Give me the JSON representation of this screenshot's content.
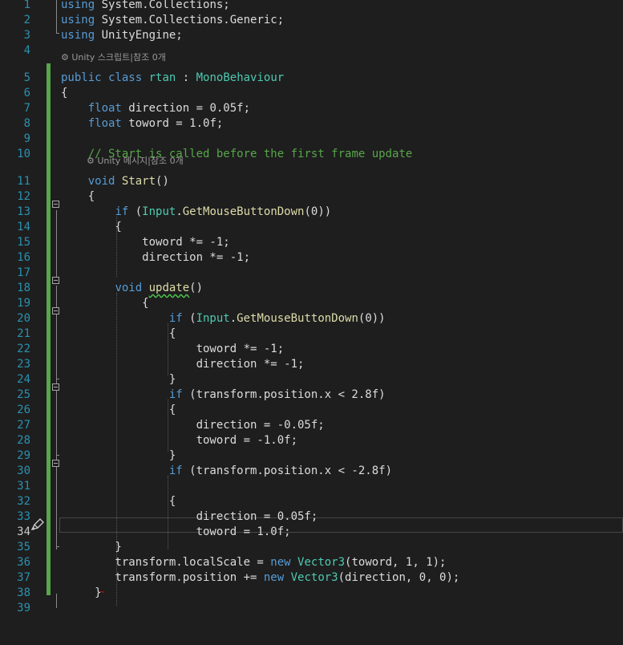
{
  "editor": {
    "current_line": "34",
    "lens_class": "Unity 스크립트|참조 0개",
    "lens_method": "Unity 메시지|참조 0개",
    "lines": [
      {
        "n": "1",
        "segs": [
          {
            "t": "using",
            "c": "kw"
          },
          {
            "t": " System.Collections;",
            "c": "id"
          }
        ]
      },
      {
        "n": "2",
        "segs": [
          {
            "t": "using",
            "c": "kw"
          },
          {
            "t": " System.Collections.Generic;",
            "c": "id"
          }
        ]
      },
      {
        "n": "3",
        "segs": [
          {
            "t": "using",
            "c": "kw"
          },
          {
            "t": " UnityEngine;",
            "c": "id"
          }
        ]
      },
      {
        "n": "4",
        "segs": []
      },
      {
        "n": "5",
        "segs": [
          {
            "t": "public",
            "c": "kw"
          },
          {
            "t": " ",
            "c": "id"
          },
          {
            "t": "class",
            "c": "kw"
          },
          {
            "t": " ",
            "c": "id"
          },
          {
            "t": "rtan",
            "c": "ty"
          },
          {
            "t": " : ",
            "c": "id"
          },
          {
            "t": "MonoBehaviour",
            "c": "ty"
          }
        ]
      },
      {
        "n": "6",
        "segs": [
          {
            "t": "{",
            "c": "id"
          }
        ]
      },
      {
        "n": "7",
        "segs": [
          {
            "t": "    ",
            "c": "id"
          },
          {
            "t": "float",
            "c": "kw"
          },
          {
            "t": " direction = 0.05f;",
            "c": "id"
          }
        ]
      },
      {
        "n": "8",
        "segs": [
          {
            "t": "    ",
            "c": "id"
          },
          {
            "t": "float",
            "c": "kw"
          },
          {
            "t": " toword = 1.0f;",
            "c": "id"
          }
        ]
      },
      {
        "n": "9",
        "segs": []
      },
      {
        "n": "10",
        "segs": [
          {
            "t": "    ",
            "c": "id"
          },
          {
            "t": "// Start is called before the first frame update",
            "c": "cm"
          }
        ]
      },
      {
        "n": "11",
        "segs": [
          {
            "t": "    ",
            "c": "id"
          },
          {
            "t": "void",
            "c": "kw"
          },
          {
            "t": " ",
            "c": "id"
          },
          {
            "t": "Start",
            "c": "fn"
          },
          {
            "t": "()",
            "c": "id"
          }
        ]
      },
      {
        "n": "12",
        "segs": [
          {
            "t": "    {",
            "c": "id"
          }
        ]
      },
      {
        "n": "13",
        "segs": [
          {
            "t": "        ",
            "c": "id"
          },
          {
            "t": "if",
            "c": "kw"
          },
          {
            "t": " (",
            "c": "id"
          },
          {
            "t": "Input",
            "c": "ty"
          },
          {
            "t": ".",
            "c": "id"
          },
          {
            "t": "GetMouseButtonDown",
            "c": "fn"
          },
          {
            "t": "(0))",
            "c": "id"
          }
        ]
      },
      {
        "n": "14",
        "segs": [
          {
            "t": "        {",
            "c": "id"
          }
        ]
      },
      {
        "n": "15",
        "segs": [
          {
            "t": "            toword *= -1;",
            "c": "id"
          }
        ]
      },
      {
        "n": "16",
        "segs": [
          {
            "t": "            direction *= -1;",
            "c": "id"
          }
        ]
      },
      {
        "n": "17",
        "segs": []
      },
      {
        "n": "18",
        "segs": [
          {
            "t": "        ",
            "c": "id"
          },
          {
            "t": "void",
            "c": "kw"
          },
          {
            "t": " ",
            "c": "id"
          },
          {
            "t": "update",
            "c": "fn squig"
          },
          {
            "t": "()",
            "c": "id"
          }
        ]
      },
      {
        "n": "19",
        "segs": [
          {
            "t": "            {",
            "c": "id"
          }
        ]
      },
      {
        "n": "20",
        "segs": [
          {
            "t": "                ",
            "c": "id"
          },
          {
            "t": "if",
            "c": "kw"
          },
          {
            "t": " (",
            "c": "id"
          },
          {
            "t": "Input",
            "c": "ty"
          },
          {
            "t": ".",
            "c": "id"
          },
          {
            "t": "GetMouseButtonDown",
            "c": "fn"
          },
          {
            "t": "(0))",
            "c": "id"
          }
        ]
      },
      {
        "n": "21",
        "segs": [
          {
            "t": "                {",
            "c": "id"
          }
        ]
      },
      {
        "n": "22",
        "segs": [
          {
            "t": "                    toword *= -1;",
            "c": "id"
          }
        ]
      },
      {
        "n": "23",
        "segs": [
          {
            "t": "                    direction *= -1;",
            "c": "id"
          }
        ]
      },
      {
        "n": "24",
        "segs": [
          {
            "t": "                }",
            "c": "id"
          }
        ]
      },
      {
        "n": "25",
        "segs": [
          {
            "t": "                ",
            "c": "id"
          },
          {
            "t": "if",
            "c": "kw"
          },
          {
            "t": " (transform.position.x < 2.8f)",
            "c": "id"
          }
        ]
      },
      {
        "n": "26",
        "segs": [
          {
            "t": "                {",
            "c": "id"
          }
        ]
      },
      {
        "n": "27",
        "segs": [
          {
            "t": "                    direction = -0.05f;",
            "c": "id"
          }
        ]
      },
      {
        "n": "28",
        "segs": [
          {
            "t": "                    toword = -1.0f;",
            "c": "id"
          }
        ]
      },
      {
        "n": "29",
        "segs": [
          {
            "t": "                }",
            "c": "id"
          }
        ]
      },
      {
        "n": "30",
        "segs": [
          {
            "t": "                ",
            "c": "id"
          },
          {
            "t": "if",
            "c": "kw"
          },
          {
            "t": " (transform.position.x < -2.8f)",
            "c": "id"
          }
        ]
      },
      {
        "n": "31",
        "segs": []
      },
      {
        "n": "32",
        "segs": [
          {
            "t": "                {",
            "c": "id"
          }
        ]
      },
      {
        "n": "33",
        "segs": [
          {
            "t": "                    direction = 0.05f;",
            "c": "id"
          }
        ]
      },
      {
        "n": "34",
        "segs": [
          {
            "t": "                    toword = 1.0f;",
            "c": "id"
          }
        ]
      },
      {
        "n": "35",
        "segs": [
          {
            "t": "        }",
            "c": "id"
          }
        ]
      },
      {
        "n": "36",
        "segs": [
          {
            "t": "        transform.localScale = ",
            "c": "id"
          },
          {
            "t": "new",
            "c": "kw"
          },
          {
            "t": " ",
            "c": "id"
          },
          {
            "t": "Vector3",
            "c": "ty"
          },
          {
            "t": "(toword, 1, 1);",
            "c": "id"
          }
        ]
      },
      {
        "n": "37",
        "segs": [
          {
            "t": "        transform.position += ",
            "c": "id"
          },
          {
            "t": "new",
            "c": "kw"
          },
          {
            "t": " ",
            "c": "id"
          },
          {
            "t": "Vector3",
            "c": "ty"
          },
          {
            "t": "(direction, 0, 0);",
            "c": "id"
          }
        ]
      },
      {
        "n": "38",
        "segs": [
          {
            "t": "     }",
            "c": "id"
          }
        ]
      },
      {
        "n": "39",
        "segs": []
      }
    ]
  }
}
